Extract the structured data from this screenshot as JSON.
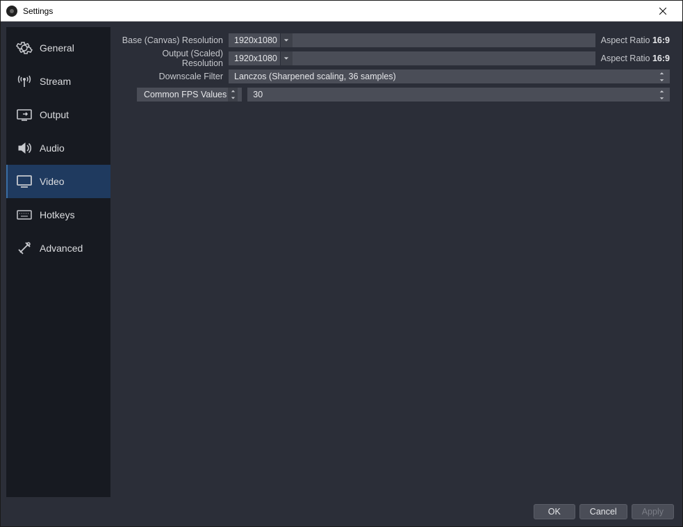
{
  "window": {
    "title": "Settings"
  },
  "sidebar": {
    "items": [
      {
        "label": "General"
      },
      {
        "label": "Stream"
      },
      {
        "label": "Output"
      },
      {
        "label": "Audio"
      },
      {
        "label": "Video"
      },
      {
        "label": "Hotkeys"
      },
      {
        "label": "Advanced"
      }
    ],
    "selected_index": 4
  },
  "video": {
    "base_res_label": "Base (Canvas) Resolution",
    "base_res_value": "1920x1080",
    "base_aspect_label": "Aspect Ratio",
    "base_aspect_value": "16:9",
    "output_res_label": "Output (Scaled) Resolution",
    "output_res_value": "1920x1080",
    "output_aspect_label": "Aspect Ratio",
    "output_aspect_value": "16:9",
    "downscale_label": "Downscale Filter",
    "downscale_value": "Lanczos (Sharpened scaling, 36 samples)",
    "fps_mode_label": "Common FPS Values",
    "fps_value": "30"
  },
  "footer": {
    "ok": "OK",
    "cancel": "Cancel",
    "apply": "Apply"
  }
}
